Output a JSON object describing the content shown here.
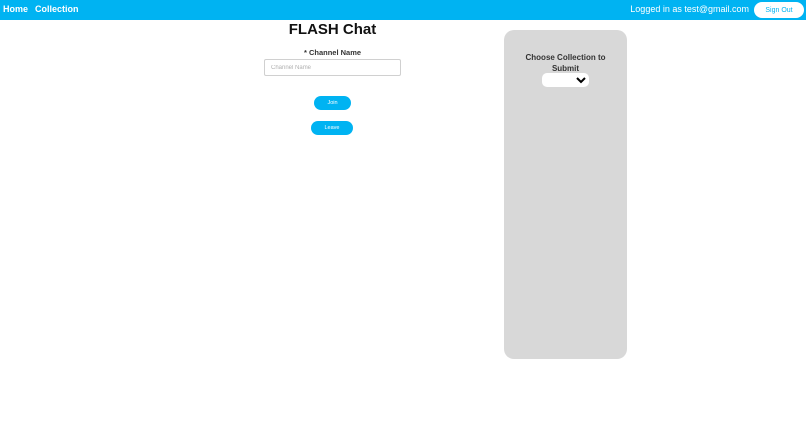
{
  "nav": {
    "home_label": "Home",
    "collection_label": "Collection",
    "logged_in_text": "Logged in as test@gmail.com",
    "signout_label": "Sign Out"
  },
  "main": {
    "title": "FLASH Chat",
    "channel_label": "* Channel Name",
    "channel_value": "",
    "channel_placeholder": "Channel Name",
    "join_label": "Join",
    "leave_label": "Leave"
  },
  "panel": {
    "title": "Choose Collection to Submit",
    "selected": ""
  },
  "colors": {
    "accent": "#00b3f2",
    "panel_bg": "#d8d8d8"
  }
}
